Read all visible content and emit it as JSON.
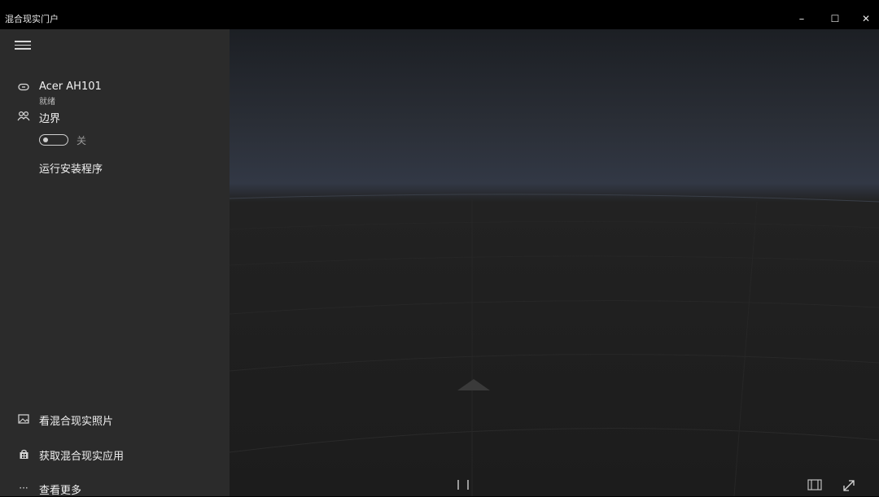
{
  "window": {
    "title": "混合现实门户",
    "controls": {
      "minimize": "–",
      "maximize": "☐",
      "close": "✕"
    }
  },
  "sidebar": {
    "device": {
      "name": "Acer AH101",
      "status": "就绪",
      "icon": "headset-icon"
    },
    "boundary": {
      "label": "边界",
      "icon": "boundary-icon",
      "toggle_state": "关",
      "toggle_on": false
    },
    "run_setup": {
      "label": "运行安装程序"
    },
    "bottom_items": [
      {
        "label": "看混合现实照片",
        "icon": "photo-icon"
      },
      {
        "label": "获取混合现实应用",
        "icon": "store-icon"
      },
      {
        "label": "查看更多",
        "icon": "more-icon",
        "glyph": "···"
      }
    ]
  },
  "viewport": {
    "controls": [
      "pause-icon",
      "mixed-view-icon",
      "expand-icon"
    ]
  },
  "colors": {
    "titlebar": "#000000",
    "sidebar": "#2b2b2b",
    "viewport_sky": "#323845",
    "floor": "#1c1c1c"
  }
}
